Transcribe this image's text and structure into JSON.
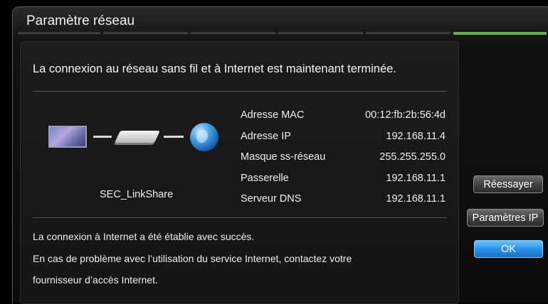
{
  "dialog": {
    "title": "Paramètre réseau",
    "progress": {
      "total_steps": 6,
      "current_step": 6
    }
  },
  "main": {
    "headline": "La connexion au réseau sans fil et à Internet est maintenant terminée.",
    "network_name": "SEC_LinkShare",
    "devices": [
      "tv-icon",
      "router-icon",
      "globe-icon"
    ],
    "info": [
      {
        "label": "Adresse MAC",
        "value": "00:12:fb:2b:56:4d"
      },
      {
        "label": "Adresse IP",
        "value": "192.168.11.4"
      },
      {
        "label": "Masque ss-réseau",
        "value": "255.255.255.0"
      },
      {
        "label": "Passerelle",
        "value": "192.168.11.1"
      },
      {
        "label": "Serveur DNS",
        "value": "192.168.11.1"
      }
    ],
    "messages": [
      "La connexion à Internet a été établie avec succès.",
      "En cas de problème avec l’utilisation du service Internet, contactez votre",
      "fournisseur d’accès Internet."
    ]
  },
  "buttons": {
    "retry": "Réessayer",
    "ip_settings": "Paramètres IP",
    "ok": "OK"
  },
  "colors": {
    "progress_active": "#5fb33c",
    "ok_button": "#2a8ee8"
  }
}
